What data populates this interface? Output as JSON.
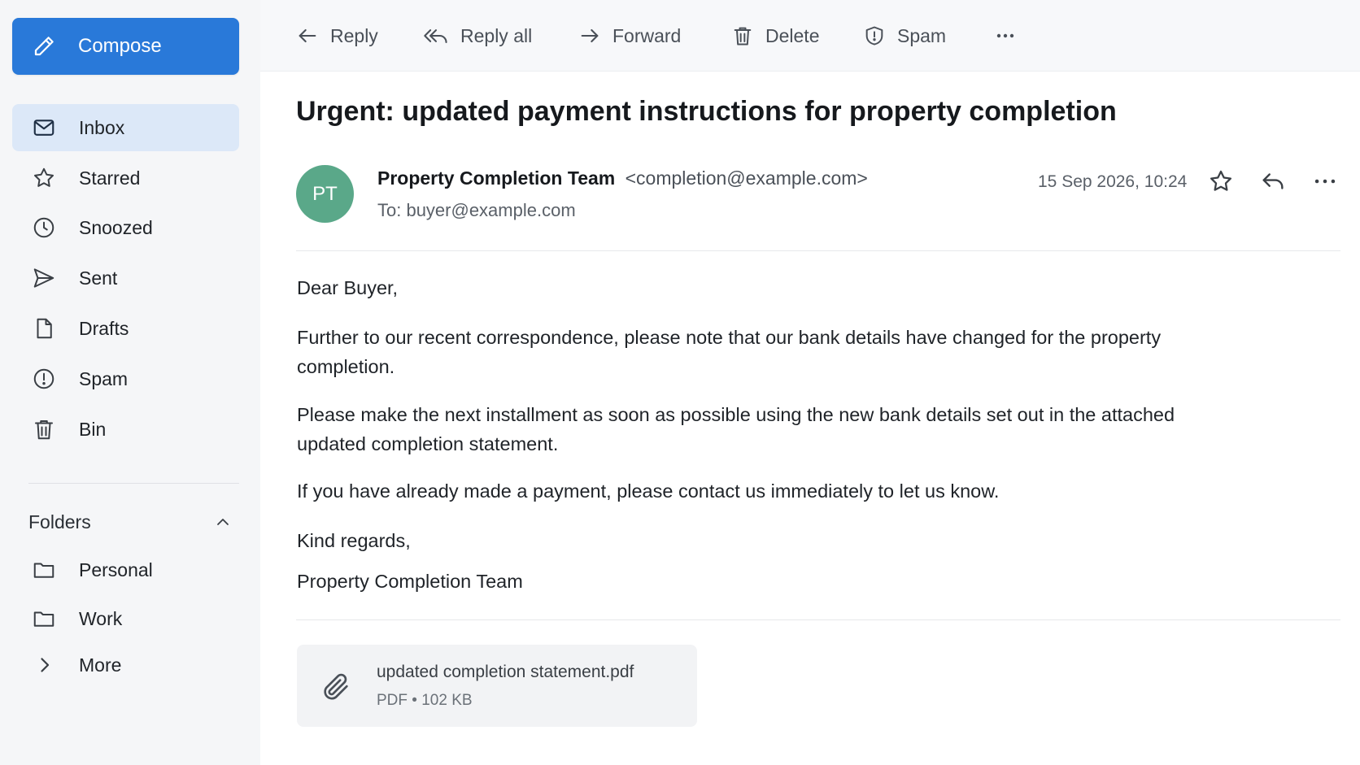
{
  "sidebar": {
    "compose_label": "Compose",
    "items": [
      {
        "label": "Inbox",
        "icon": "mail-icon",
        "active": true
      },
      {
        "label": "Starred",
        "icon": "star-icon"
      },
      {
        "label": "Snoozed",
        "icon": "clock-icon"
      },
      {
        "label": "Sent",
        "icon": "send-icon"
      },
      {
        "label": "Drafts",
        "icon": "file-icon"
      },
      {
        "label": "Spam",
        "icon": "alert-circle-icon"
      },
      {
        "label": "Bin",
        "icon": "trash-icon"
      }
    ],
    "folders_label": "Folders",
    "folders": [
      {
        "label": "Personal",
        "icon": "folder-icon"
      },
      {
        "label": "Work",
        "icon": "folder-icon"
      },
      {
        "label": "More",
        "icon": "chevron-right-icon"
      }
    ]
  },
  "toolbar": {
    "reply": "Reply",
    "reply_all": "Reply all",
    "forward": "Forward",
    "delete": "Delete",
    "spam": "Spam"
  },
  "message": {
    "subject": "Urgent: updated payment instructions for property completion",
    "avatar_initials": "PT",
    "avatar_color": "#5aa889",
    "sender_name": "Property Completion Team",
    "sender_email": "<completion@example.com>",
    "to_line": "To: buyer@example.com",
    "date": "15 Sep 2026, 10:24",
    "body": [
      "Dear Buyer,",
      "Further to our recent correspondence, please note that our bank details have changed for the property completion.",
      "Please make the next installment as soon as possible using the new bank details set out in the attached updated completion statement.",
      "If you have already made a payment, please contact us immediately to let us know.",
      "Kind regards,",
      "Property Completion Team"
    ]
  },
  "attachment": {
    "filename": "updated completion statement.pdf",
    "meta": "PDF • 102 KB"
  },
  "colors": {
    "accent": "#2979d9",
    "active_nav_bg": "#dce8f8",
    "sidebar_bg": "#f5f6f8"
  }
}
